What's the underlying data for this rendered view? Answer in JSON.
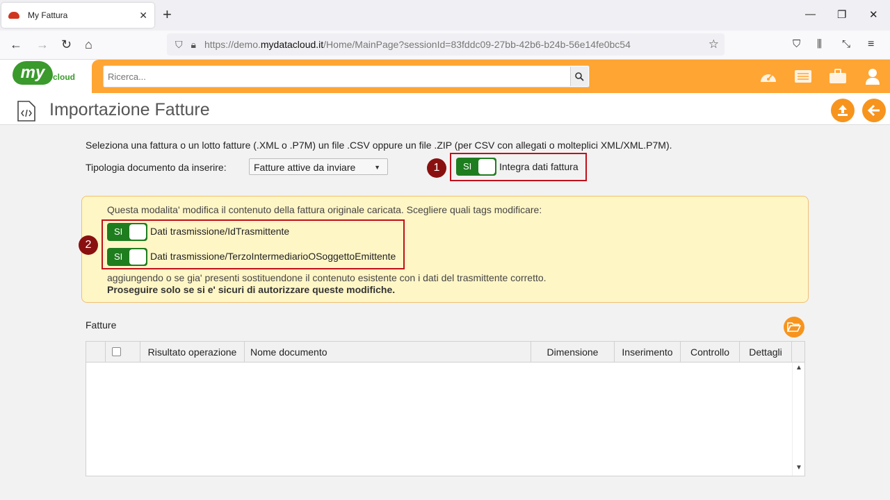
{
  "browser": {
    "tab_title": "My Fattura",
    "url_prefix": "https://demo.",
    "url_domain": "mydatacloud.it",
    "url_suffix": "/Home/MainPage?sessionId=83fddc09-27bb-42b6-b24b-56e14fe0bc54"
  },
  "header": {
    "logo_my": "my",
    "logo_cloud": "cloud",
    "search_placeholder": "Ricerca...",
    "accent": "#ffa533"
  },
  "page": {
    "title": "Importazione Fatture"
  },
  "form": {
    "intro": "Seleziona una fattura o un lotto fatture (.XML o .P7M) un file .CSV oppure un file .ZIP (per CSV con allegati o molteplici XML/XML.P7M).",
    "tipologia_label": "Tipologia documento da inserire:",
    "tipologia_value": "Fatture attive da inviare",
    "badge1": "1",
    "integra_toggle": "SI",
    "integra_label": "Integra dati fattura"
  },
  "warning": {
    "line1": "Questa modalita' modifica il contenuto della fattura originale caricata. Scegliere quali tags modificare:",
    "badge2": "2",
    "toggle1_state": "SI",
    "toggle1_label": "Dati trasmissione/IdTrasmittente",
    "toggle2_state": "SI",
    "toggle2_label": "Dati trasmissione/TerzoIntermediarioOSoggettoEmittente",
    "line2": "aggiungendo o se gia' presenti sostituendone il contenuto esistente con i dati del trasmittente corretto.",
    "line3": "Proseguire solo se si e' sicuri di autorizzare queste modifiche."
  },
  "table": {
    "section_label": "Fatture",
    "columns": [
      "Risultato operazione",
      "Nome documento",
      "Dimensione",
      "Inserimento",
      "Controllo",
      "Dettagli"
    ],
    "rows": []
  }
}
